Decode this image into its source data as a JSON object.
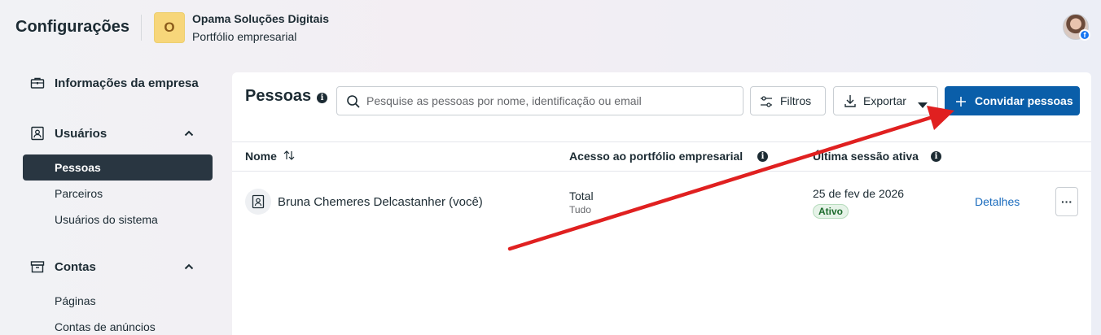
{
  "header": {
    "title": "Configurações",
    "business": {
      "logo_letter": "O",
      "name": "Opama Soluções Digitais",
      "subtitle": "Portfólio empresarial"
    },
    "avatar_badge": "f"
  },
  "sidebar": {
    "items": [
      {
        "label": "Informações da empresa",
        "icon": "briefcase-icon",
        "type": "section"
      },
      {
        "label": "Usuários",
        "icon": "user-badge-icon",
        "type": "section",
        "expanded": true
      },
      {
        "label": "Pessoas",
        "type": "sub",
        "active": true
      },
      {
        "label": "Parceiros",
        "type": "sub"
      },
      {
        "label": "Usuários do sistema",
        "type": "sub"
      },
      {
        "label": "Contas",
        "icon": "archive-icon",
        "type": "section",
        "expanded": true
      },
      {
        "label": "Páginas",
        "type": "sub"
      },
      {
        "label": "Contas de anúncios",
        "type": "sub"
      }
    ]
  },
  "main": {
    "title": "Pessoas",
    "search": {
      "placeholder": "Pesquise as pessoas por nome, identificação ou email",
      "value": ""
    },
    "buttons": {
      "filters": "Filtros",
      "export": "Exportar",
      "invite": "Convidar pessoas"
    },
    "table": {
      "columns": [
        "Nome",
        "Acesso ao portfólio empresarial",
        "Última sessão ativa"
      ],
      "rows": [
        {
          "name": "Bruna Chemeres Delcastanher (você)",
          "access": "Total",
          "access_detail": "Tudo",
          "last_session": "25 de fev de 2026",
          "status": "Ativo",
          "action": "Detalhes",
          "more": "···"
        }
      ]
    }
  },
  "colors": {
    "primary": "#0a5ea9",
    "annotation_arrow": "#e02020",
    "active_nav": "#293641",
    "link": "#1a6bbd"
  }
}
